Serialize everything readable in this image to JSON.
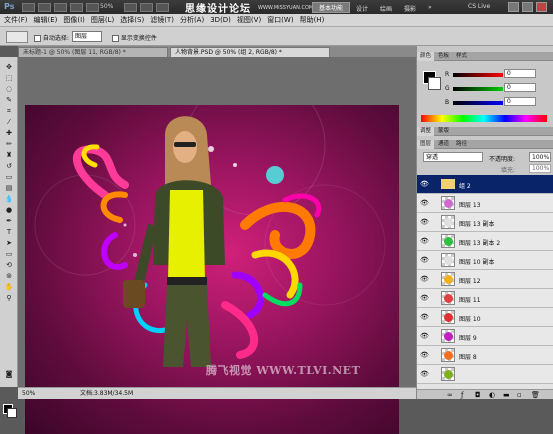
{
  "app": {
    "logo": "Ps",
    "zoom": "50%",
    "watermark": "思缘设计论坛",
    "watermark_url": "WWW.MISSYUAN.COM",
    "workspace_active": "基本功能",
    "workspaces": [
      "设计",
      "绘画",
      "摄影"
    ],
    "cs_live": "CS Live"
  },
  "menu": [
    "文件(F)",
    "编辑(E)",
    "图像(I)",
    "图层(L)",
    "选择(S)",
    "滤镜(T)",
    "分析(A)",
    "3D(D)",
    "视图(V)",
    "窗口(W)",
    "帮助(H)"
  ],
  "options": {
    "auto_select": "自动选择:",
    "auto_select_value": "图层",
    "show_transform": "显示变换控件"
  },
  "tabs": [
    "未标题-1 @ 50% (图层 11, RGB/8) *",
    "人物背景.PSD @ 50% (组 2, RGB/8) *"
  ],
  "status": {
    "zoom": "50%",
    "doc": "文档:3.83M/34.5M"
  },
  "credit": "腾飞视觉 WWW.TLVI.NET",
  "color_panel": {
    "tabs": [
      "颜色",
      "色板",
      "样式"
    ],
    "channels": [
      {
        "label": "R",
        "value": "0"
      },
      {
        "label": "G",
        "value": "0"
      },
      {
        "label": "B",
        "value": "0"
      }
    ]
  },
  "adjust_tabs": [
    "调整",
    "蒙版"
  ],
  "layers_panel": {
    "tabs": [
      "图层",
      "通道",
      "路径"
    ],
    "blend": "穿透",
    "opacity_label": "不透明度:",
    "opacity": "100%",
    "fill_label": "填充:",
    "fill": "100%",
    "layers": [
      {
        "name": "组 2",
        "selected": true,
        "color": ""
      },
      {
        "name": "图层 13",
        "selected": false,
        "color": "#d06ad0"
      },
      {
        "name": "图层 13 副本",
        "selected": false,
        "color": "#e0e0e0"
      },
      {
        "name": "图层 13 副本 2",
        "selected": false,
        "color": "#30c040"
      },
      {
        "name": "图层 10 副本",
        "selected": false,
        "color": "#e0e0e0"
      },
      {
        "name": "图层 12",
        "selected": false,
        "color": "#f0b020"
      },
      {
        "name": "图层 11",
        "selected": false,
        "color": "#e04040"
      },
      {
        "name": "图层 10",
        "selected": false,
        "color": "#e03030"
      },
      {
        "name": "图层 9",
        "selected": false,
        "color": "#c020c0"
      },
      {
        "name": "图层 8",
        "selected": false,
        "color": "#f07020"
      },
      {
        "name": "",
        "selected": false,
        "color": "#80b020"
      }
    ]
  }
}
